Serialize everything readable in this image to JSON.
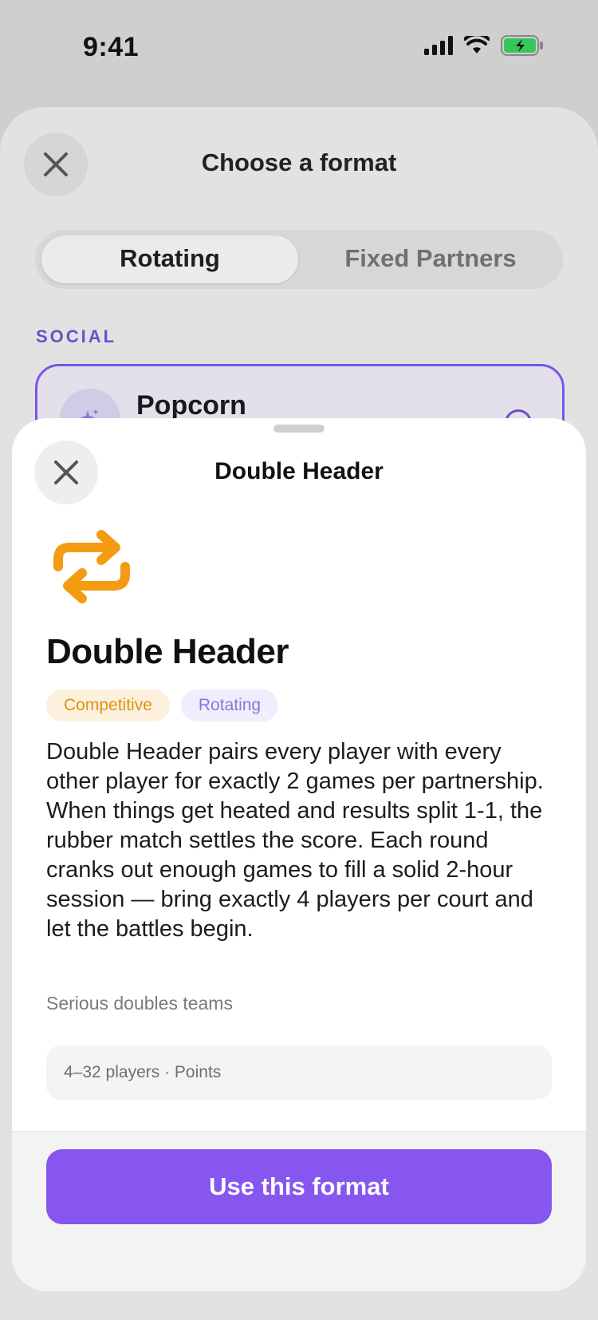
{
  "status_bar": {
    "time": "9:41"
  },
  "background": {
    "title": "Choose a format",
    "segment": {
      "options": [
        "Rotating",
        "Fixed Partners"
      ],
      "selected": "Rotating"
    },
    "section_label": "SOCIAL",
    "card": {
      "name": "Popcorn"
    }
  },
  "sheet": {
    "title": "Double Header",
    "format_name": "Double Header",
    "tags": [
      "Competitive",
      "Rotating"
    ],
    "description": "Double Header pairs every player with every other player for exactly 2 games per partnership. When things get heated and results split 1-1, the rubber match settles the score. Each round cranks out enough games to fill a solid 2-hour session — bring exactly 4 players per court and let the battles begin.",
    "audience": "Serious doubles teams",
    "meta": "4–32 players · Points",
    "cta_label": "Use this format"
  },
  "colors": {
    "accent": "#8656EE",
    "format_icon": "#F39C12",
    "tag_competitive_bg": "#FDF1DD",
    "tag_competitive_text": "#E09112",
    "tag_rotating_bg": "#F0EDFD",
    "tag_rotating_text": "#8A78D6"
  },
  "icons": {
    "close": "close-icon",
    "format": "repeat-icon",
    "signal": "cellular-signal-icon",
    "wifi": "wifi-icon",
    "battery": "battery-charging-icon",
    "info": "info-icon",
    "sparkle": "sparkle-icon"
  }
}
